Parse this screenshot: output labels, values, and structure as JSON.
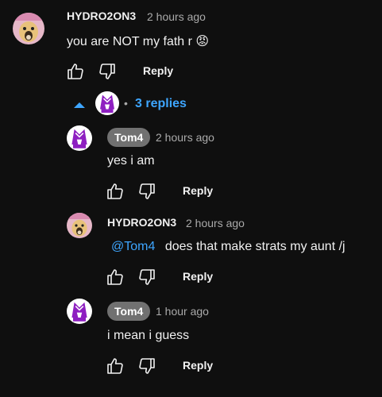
{
  "colors": {
    "background": "#0f0f0f",
    "text": "#f1f1f1",
    "muted": "#aaaaaa",
    "link": "#3ea6ff",
    "chip": "#717171",
    "avatar_purple": "#8e1fc1"
  },
  "top_comment": {
    "author": "HYDRO2ON3",
    "time": "2 hours ago",
    "text": "you are NOT my fath r 😡",
    "reply_label": "Reply",
    "like_icon": "thumbs-up-icon",
    "dislike_icon": "thumbs-down-icon"
  },
  "replies_toggle": {
    "label": "3 replies",
    "icon": "chevron-up-icon"
  },
  "replies": [
    {
      "author": "Tom4",
      "time": "2 hours ago",
      "text": "yes i am",
      "reply_label": "Reply"
    },
    {
      "author": "HYDRO2ON3",
      "time": "2 hours ago",
      "mention": "@Tom4",
      "text": "does that make strats my aunt /j",
      "reply_label": "Reply"
    },
    {
      "author": "Tom4",
      "time": "1 hour ago",
      "text": "i mean i guess",
      "reply_label": "Reply"
    }
  ]
}
